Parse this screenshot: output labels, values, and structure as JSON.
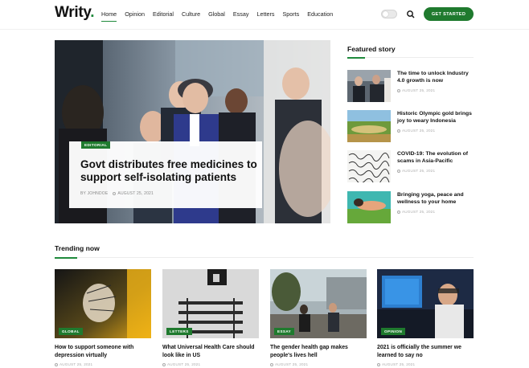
{
  "brand": {
    "logo_text": "Writy",
    "logo_dot": ".",
    "accent": "#1f7a2e"
  },
  "nav": {
    "items": [
      {
        "label": "Home",
        "active": true
      },
      {
        "label": "Opinion"
      },
      {
        "label": "Editorial"
      },
      {
        "label": "Culture"
      },
      {
        "label": "Global"
      },
      {
        "label": "Essay"
      },
      {
        "label": "Letters"
      },
      {
        "label": "Sports"
      },
      {
        "label": "Education"
      }
    ],
    "theme_toggle": "toggle-icon",
    "search_icon": "search-icon",
    "cta_label": "GET STARTED"
  },
  "hero": {
    "category": "EDITORIAL",
    "title": "Govt distributes free medicines to support self-isolating patients",
    "author": "BY JOHNDOE",
    "date": "AUGUST 25, 2021"
  },
  "featured": {
    "heading": "Featured story",
    "items": [
      {
        "title": "The time to unlock Industry 4.0 growth is now",
        "date": "AUGUST 25, 2021"
      },
      {
        "title": "Historic Olympic gold brings joy to weary Indonesia",
        "date": "AUGUST 25, 2021"
      },
      {
        "title": "COVID-19: The evolution of scams in Asia-Pacific",
        "date": "AUGUST 25, 2021"
      },
      {
        "title": "Bringing yoga, peace and wellness to your home",
        "date": "AUGUST 25, 2021"
      }
    ]
  },
  "trending": {
    "heading": "Trending now",
    "items": [
      {
        "category": "GLOBAL",
        "title": "How to support someone with depression virtually",
        "date": "AUGUST 25, 2021"
      },
      {
        "category": "LETTERS",
        "title": "What Universal Health Care should look like in US",
        "date": "AUGUST 25, 2021"
      },
      {
        "category": "ESSAY",
        "title": "The gender health gap makes people's lives hell",
        "date": "AUGUST 25, 2021"
      },
      {
        "category": "OPINION",
        "title": "2021 is officially the summer we learned to say no",
        "date": "AUGUST 25, 2021"
      }
    ]
  }
}
